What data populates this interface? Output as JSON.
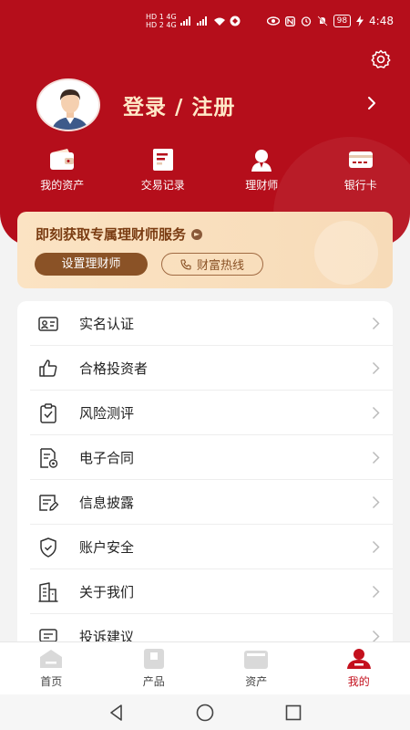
{
  "status_bar": {
    "left_line1": "HD 1 4G",
    "left_line2": "HD 2 4G",
    "battery": "98",
    "time": "4:48"
  },
  "header": {
    "login_label": "登录 / 注册"
  },
  "quick_actions": [
    {
      "label": "我的资产",
      "icon": "wallet-icon"
    },
    {
      "label": "交易记录",
      "icon": "record-icon"
    },
    {
      "label": "理财师",
      "icon": "advisor-icon"
    },
    {
      "label": "银行卡",
      "icon": "bank-card-icon"
    }
  ],
  "advisor_card": {
    "title": "即刻获取专属理财师服务",
    "set_button": "设置理财师",
    "hotline_button": "财富热线"
  },
  "menu": [
    {
      "label": "实名认证",
      "icon": "id-card-icon"
    },
    {
      "label": "合格投资者",
      "icon": "thumbs-up-icon"
    },
    {
      "label": "风险测评",
      "icon": "clipboard-check-icon"
    },
    {
      "label": "电子合同",
      "icon": "contract-icon"
    },
    {
      "label": "信息披露",
      "icon": "document-edit-icon"
    },
    {
      "label": "账户安全",
      "icon": "shield-check-icon"
    },
    {
      "label": "关于我们",
      "icon": "building-icon"
    },
    {
      "label": "投诉建议",
      "icon": "feedback-icon"
    }
  ],
  "tabbar": [
    {
      "label": "首页",
      "icon": "home-icon",
      "active": false
    },
    {
      "label": "产品",
      "icon": "product-icon",
      "active": false
    },
    {
      "label": "资产",
      "icon": "wallet-icon",
      "active": false
    },
    {
      "label": "我的",
      "icon": "profile-icon",
      "active": true
    }
  ],
  "colors": {
    "brand_red": "#b50e1b",
    "gold_text": "#ffe9c8",
    "card_bg": "#fbe3c3",
    "card_brown": "#8a5226"
  }
}
